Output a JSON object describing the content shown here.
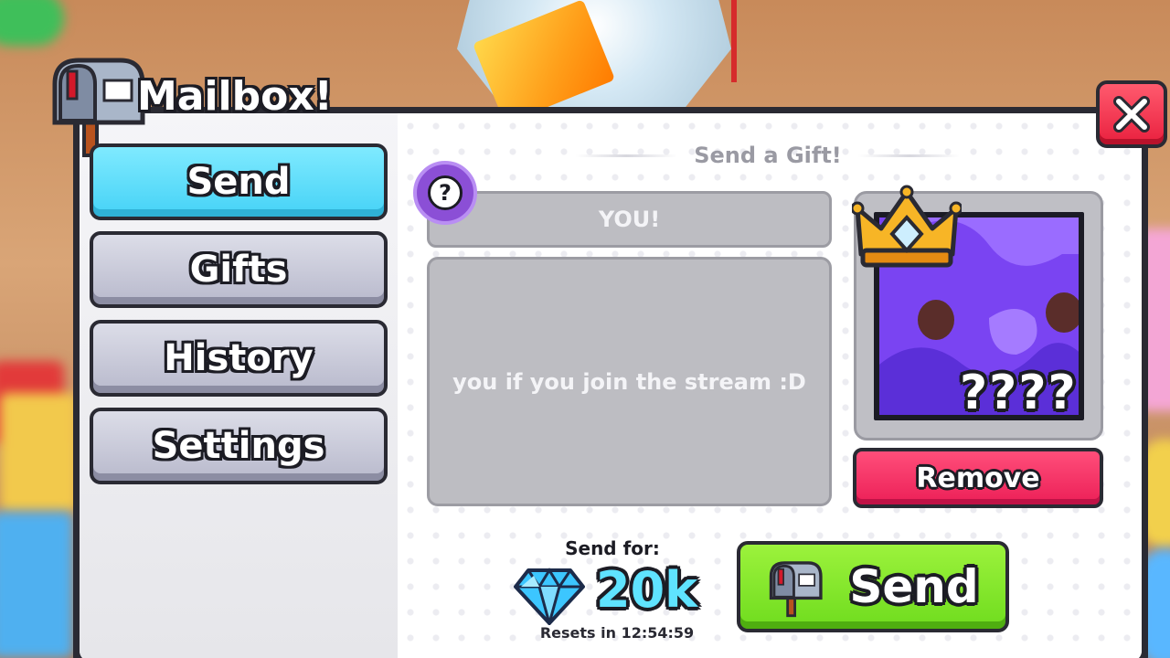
{
  "window": {
    "title": "Mailbox!"
  },
  "sidebar": {
    "items": [
      {
        "label": "Send",
        "active": true
      },
      {
        "label": "Gifts",
        "active": false
      },
      {
        "label": "History",
        "active": false
      },
      {
        "label": "Settings",
        "active": false
      }
    ]
  },
  "main": {
    "section_title": "Send a Gift!",
    "recipient_value": "YOU!",
    "message_value": "you if you join the stream :D",
    "help_glyph": "?",
    "pet": {
      "name_hidden": "????",
      "remove_label": "Remove"
    },
    "cost": {
      "label": "Send for:",
      "amount": "20k",
      "resets": "Resets in 12:54:59"
    },
    "send_label": "Send"
  },
  "icons": {
    "title_icon": "mailbox-icon",
    "close": "close-icon",
    "help": "question-icon",
    "crown": "crown-icon",
    "gem": "diamond-icon",
    "send": "mailbox-icon"
  },
  "colors": {
    "active_tab": "#45d2f6",
    "send_button": "#6fdc1e",
    "remove_button": "#ec1f57",
    "close_button": "#e9203e",
    "price_text": "#5fe3ff"
  }
}
